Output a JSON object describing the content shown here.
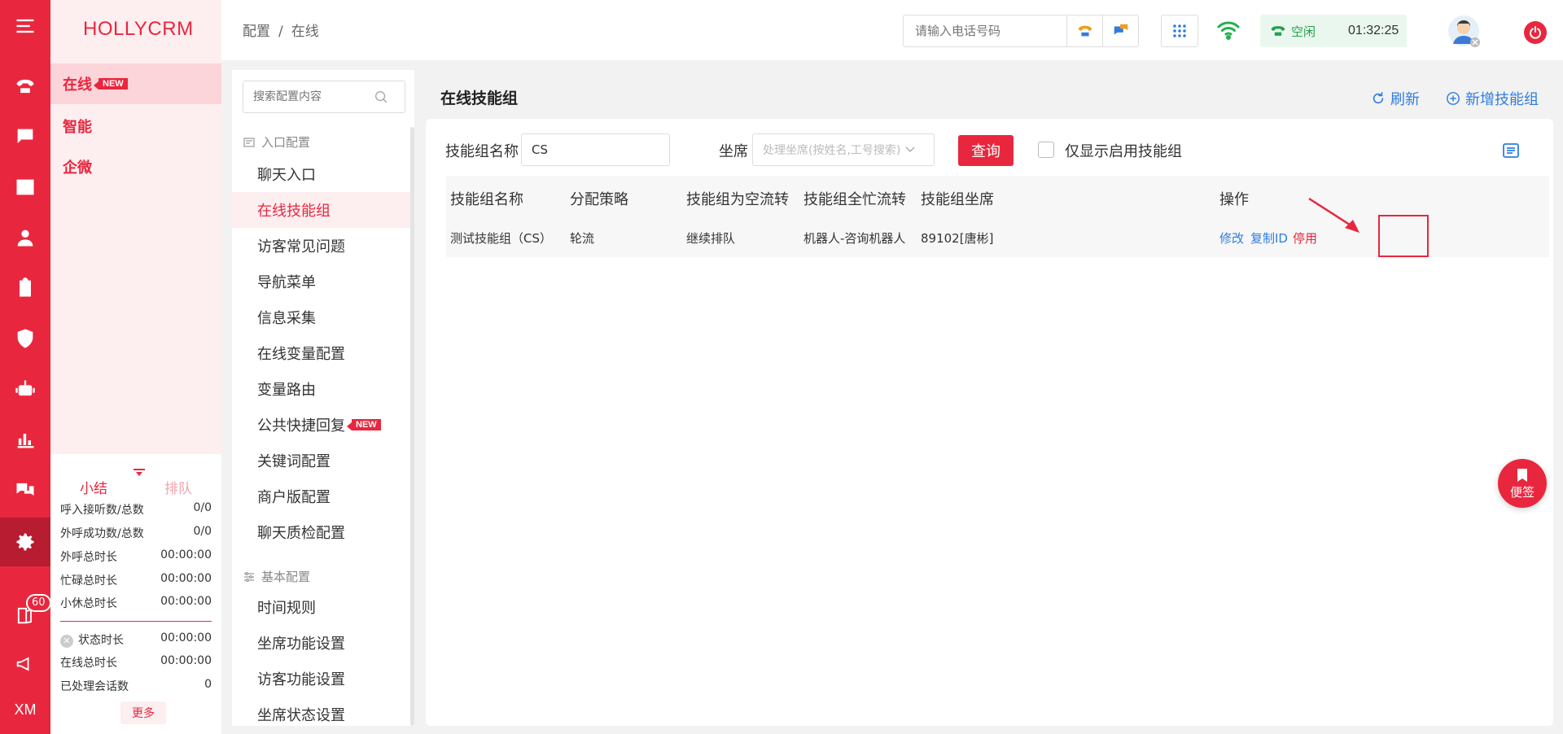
{
  "brand": "HOLLYCRM",
  "left_nav": {
    "items": [
      {
        "label": "在线",
        "new": "NEW"
      },
      {
        "label": "智能"
      },
      {
        "label": "企微"
      }
    ],
    "badge_count": "60",
    "xm": "XM"
  },
  "stats": {
    "tabs": [
      "小结",
      "排队"
    ],
    "rows": [
      {
        "label": "呼入接听数/总数",
        "value": "0/0"
      },
      {
        "label": "外呼成功数/总数",
        "value": "0/0"
      },
      {
        "label": "外呼总时长",
        "value": "00:00:00"
      },
      {
        "label": "忙碌总时长",
        "value": "00:00:00"
      },
      {
        "label": "小休总时长",
        "value": "00:00:00"
      },
      {
        "label": "状态时长",
        "value": "00:00:00"
      },
      {
        "label": "在线总时长",
        "value": "00:00:00"
      },
      {
        "label": "已处理会话数",
        "value": "0"
      }
    ],
    "more": "更多"
  },
  "header": {
    "breadcrumb": [
      "配置",
      "/",
      "在线"
    ],
    "phone_placeholder": "请输入电话号码",
    "status": "空闲",
    "timer": "01:32:25"
  },
  "config_menu": {
    "search_placeholder": "搜索配置内容",
    "groups": [
      {
        "label": "入口配置"
      },
      {
        "label": "基本配置"
      }
    ],
    "items": [
      "聊天入口",
      "在线技能组",
      "访客常见问题",
      "导航菜单",
      "信息采集",
      "在线变量配置",
      "变量路由",
      "公共快捷回复",
      "关键词配置",
      "商户版配置",
      "聊天质检配置",
      "时间规则",
      "坐席功能设置",
      "访客功能设置",
      "坐席状态设置"
    ],
    "new_tag": "NEW"
  },
  "main": {
    "title": "在线技能组",
    "refresh": "刷新",
    "add": "新增技能组",
    "filters": {
      "name_label": "技能组名称",
      "name_value": "CS",
      "agent_label": "坐席",
      "agent_placeholder": "处理坐席(按姓名,工号搜索)",
      "query": "查询",
      "only_enabled": "仅显示启用技能组"
    },
    "columns": [
      "技能组名称",
      "分配策略",
      "技能组为空流转",
      "技能组全忙流转",
      "技能组坐席",
      "操作"
    ],
    "rows": [
      {
        "name": "测试技能组（CS）",
        "strategy": "轮流",
        "empty_flow": "继续排队",
        "busy_flow": "机器人-咨询机器人",
        "agents": "89102[唐彬]",
        "ops": [
          "修改",
          "复制ID",
          "停用"
        ]
      }
    ]
  },
  "fab": "便签",
  "colors": {
    "primary": "#e8273e",
    "link": "#2f7de1",
    "idle": "#22a14b"
  }
}
